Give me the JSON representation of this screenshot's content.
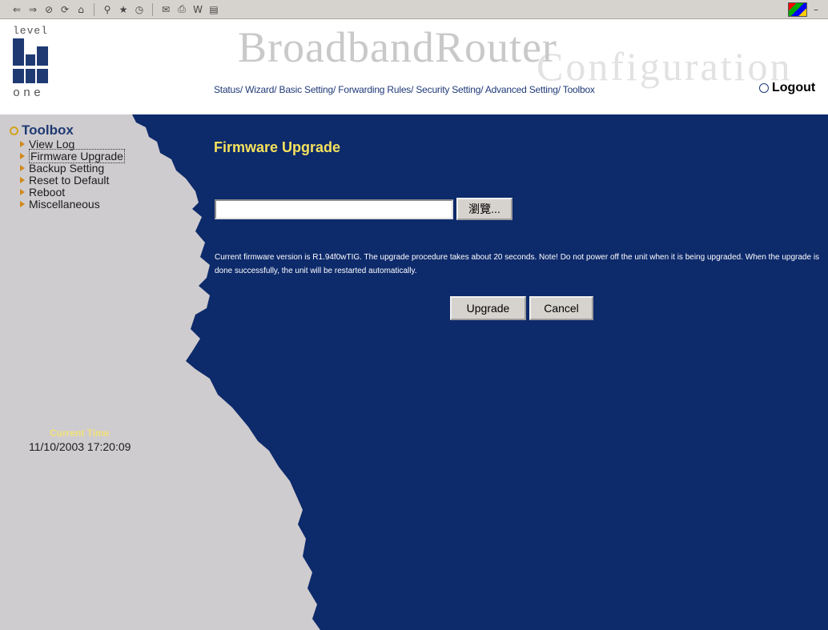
{
  "browser": {
    "toolbar_icons": [
      "back-icon",
      "forward-icon",
      "stop-icon",
      "refresh-icon",
      "home-icon",
      "search-icon",
      "favorites-icon",
      "history-icon",
      "mail-icon",
      "print-icon",
      "edit-icon",
      "discuss-icon"
    ]
  },
  "header": {
    "logo": {
      "top": "level",
      "bottom": "one"
    },
    "title": "BroadbandRouter",
    "subtitle": "Configuration",
    "nav": [
      "Status",
      "Wizard",
      "Basic Setting",
      "Forwarding Rules",
      "Security Setting",
      "Advanced Setting",
      "Toolbox"
    ],
    "logout": "Logout"
  },
  "sidebar": {
    "title": "Toolbox",
    "items": [
      {
        "label": "View Log"
      },
      {
        "label": "Firmware Upgrade"
      },
      {
        "label": "Backup Setting"
      },
      {
        "label": "Reset to Default"
      },
      {
        "label": "Reboot"
      },
      {
        "label": "Miscellaneous"
      }
    ],
    "current_time_label": "Current Time",
    "current_time_value": "11/10/2003 17:20:09"
  },
  "main": {
    "title": "Firmware Upgrade",
    "file_input": {
      "value": "",
      "placeholder": ""
    },
    "browse_label": "瀏覽...",
    "note": "Current firmware version is R1.94f0wTIG. The upgrade procedure takes about 20 seconds. Note! Do not power off the unit when it is being upgraded. When the upgrade is done successfully, the unit will be restarted automatically.",
    "upgrade_label": "Upgrade",
    "cancel_label": "Cancel"
  },
  "colors": {
    "content_bg": "#0d2a6b",
    "sidebar_bg": "#cfcccf",
    "title_yellow": "#f5e25c",
    "link_blue": "#203a78"
  }
}
